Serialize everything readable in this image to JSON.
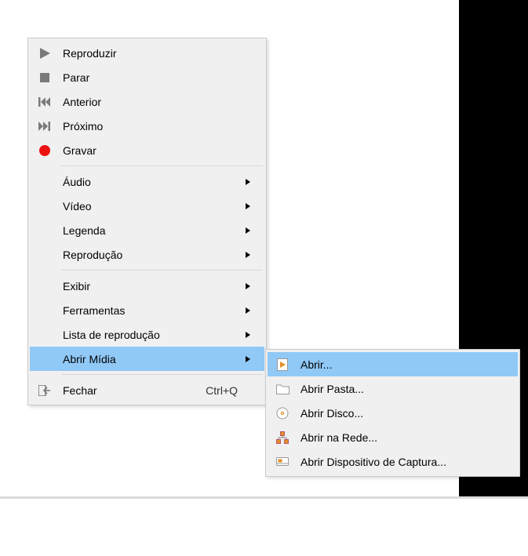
{
  "contextMenu": {
    "play": "Reproduzir",
    "stop": "Parar",
    "previous": "Anterior",
    "next": "Próximo",
    "record": "Gravar",
    "audio": "Áudio",
    "video": "Vídeo",
    "subtitle": "Legenda",
    "playback": "Reprodução",
    "view": "Exibir",
    "tools": "Ferramentas",
    "playlist": "Lista de reprodução",
    "openMedia": "Abrir Mídia",
    "close": "Fechar",
    "closeShortcut": "Ctrl+Q"
  },
  "submenu": {
    "open": "Abrir...",
    "openFolder": "Abrir Pasta...",
    "openDisc": "Abrir Disco...",
    "openNetwork": "Abrir na Rede...",
    "openCapture": "Abrir Dispositivo de Captura..."
  },
  "colors": {
    "highlight": "#90c8f6",
    "menuBg": "#f0f0f0",
    "accentOrange": "#e58e27"
  }
}
